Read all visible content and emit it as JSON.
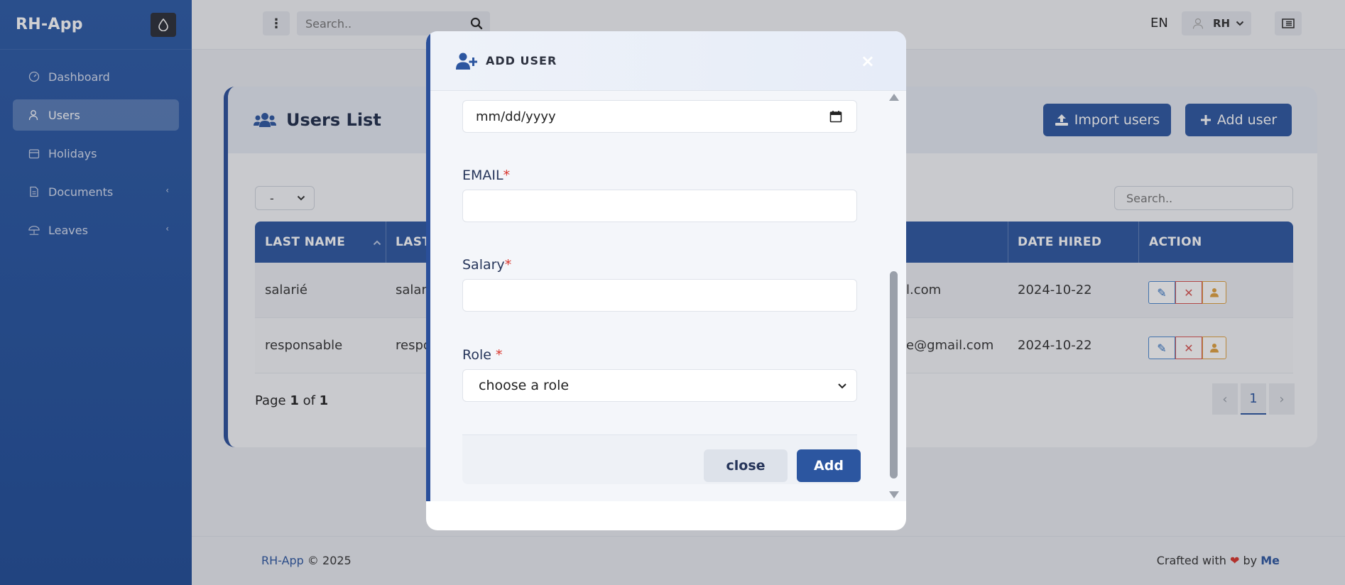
{
  "app": {
    "name": "RH-App"
  },
  "sidebar": {
    "items": [
      {
        "label": "Dashboard",
        "icon": "dashboard-icon"
      },
      {
        "label": "Users",
        "icon": "users-icon",
        "active": true
      },
      {
        "label": "Holidays",
        "icon": "calendar-icon"
      },
      {
        "label": "Documents",
        "icon": "document-icon",
        "has_children": true
      },
      {
        "label": "Leaves",
        "icon": "umbrella-icon",
        "has_children": true
      }
    ]
  },
  "topbar": {
    "search_placeholder": "Search..",
    "language": "EN",
    "user_initials": "RH"
  },
  "users_page": {
    "title": "Users List",
    "import_label": "Import users",
    "add_label": "Add user",
    "page_size": "-",
    "search_placeholder": "Search..",
    "columns": [
      "LAST NAME",
      "LAST",
      "DATE HIRED",
      "ACTION"
    ],
    "rows": [
      {
        "last_name": "salarié",
        "last": "salari",
        "email": "il.com",
        "date_hired": "2024-10-22"
      },
      {
        "last_name": "responsable",
        "last": "respo",
        "email": "le@gmail.com",
        "date_hired": "2024-10-22"
      }
    ],
    "pagination": {
      "prefix": "Page",
      "current": "1",
      "of": "of",
      "total": "1",
      "active_page": "1"
    }
  },
  "footer": {
    "brand": "RH-App",
    "copyright": "© 2025",
    "crafted": "Crafted with",
    "by": "by",
    "author": "Me"
  },
  "modal": {
    "title": "ADD USER",
    "close_icon": "×",
    "date_placeholder": "mm/dd/yyyy",
    "email_label": "EMAIL",
    "salary_label": "Salary",
    "role_label": "Role",
    "required_mark": "*",
    "role_selected": "choose a role",
    "close_button": "close",
    "add_button": "Add"
  },
  "colors": {
    "primary": "#2c56a0",
    "sidebar": "#224f9c",
    "danger": "#d9534f",
    "warning": "#e0a13e"
  }
}
